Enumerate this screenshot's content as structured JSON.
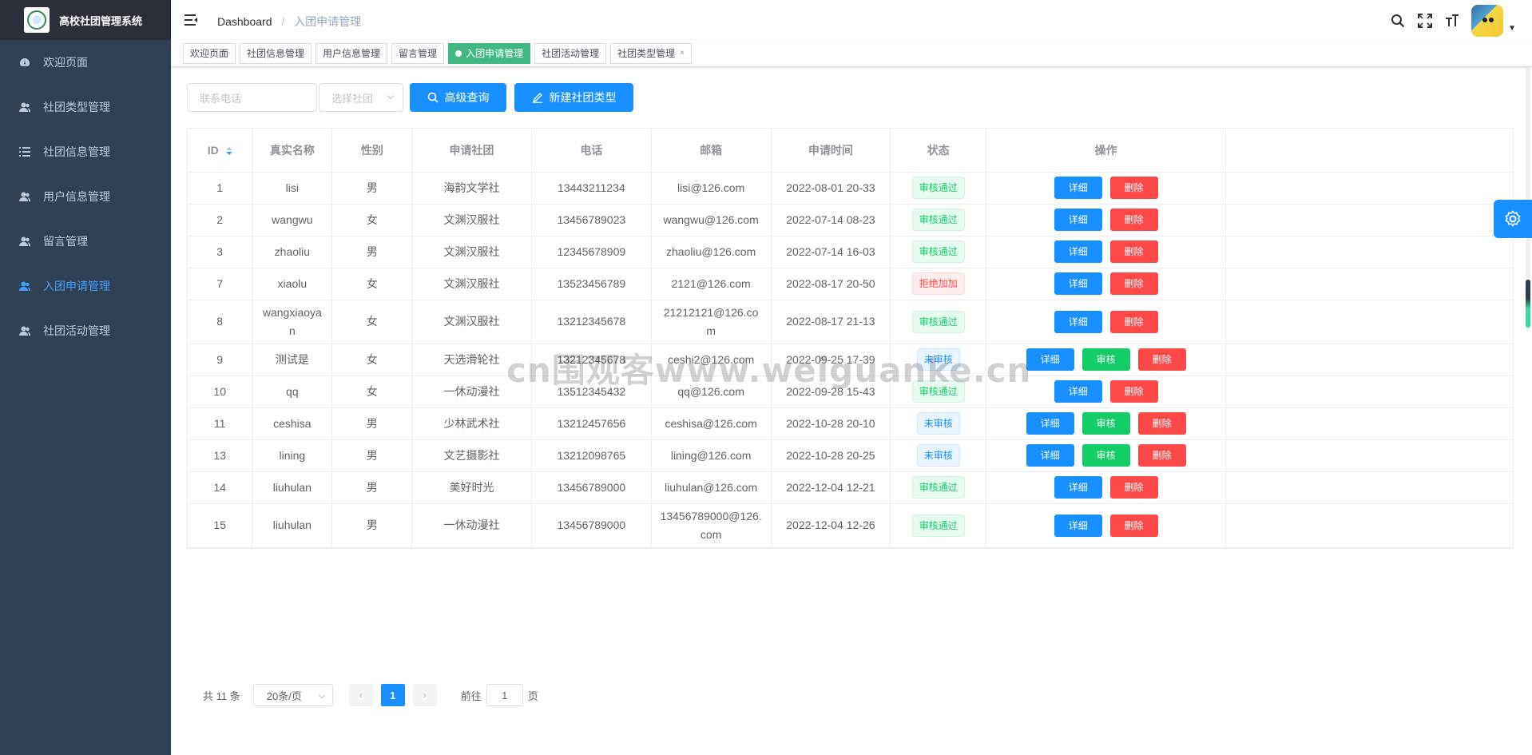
{
  "app": {
    "title": "高校社团管理系统"
  },
  "sidebar": {
    "items": [
      {
        "label": "欢迎页面",
        "icon": "dashboard-icon",
        "active": false
      },
      {
        "label": "社团类型管理",
        "icon": "user-icon",
        "active": false
      },
      {
        "label": "社团信息管理",
        "icon": "list-icon",
        "active": false
      },
      {
        "label": "用户信息管理",
        "icon": "user-icon",
        "active": false
      },
      {
        "label": "留言管理",
        "icon": "user-icon",
        "active": false
      },
      {
        "label": "入团申请管理",
        "icon": "user-icon",
        "active": true
      },
      {
        "label": "社团活动管理",
        "icon": "user-icon",
        "active": false
      }
    ]
  },
  "navbar": {
    "breadcrumb": {
      "home": "Dashboard",
      "separator": "/",
      "current": "入团申请管理"
    }
  },
  "tags": [
    {
      "label": "欢迎页面",
      "active": false,
      "closable": false
    },
    {
      "label": "社团信息管理",
      "active": false,
      "closable": false
    },
    {
      "label": "用户信息管理",
      "active": false,
      "closable": false
    },
    {
      "label": "留言管理",
      "active": false,
      "closable": false
    },
    {
      "label": "入团申请管理",
      "active": true,
      "closable": false
    },
    {
      "label": "社团活动管理",
      "active": false,
      "closable": false
    },
    {
      "label": "社团类型管理",
      "active": false,
      "closable": true,
      "close_symbol": "×"
    }
  ],
  "filters": {
    "phone_placeholder": "联系电话",
    "club_placeholder": "选择社团",
    "search_label": "高级查询",
    "create_label": "新建社团类型"
  },
  "table": {
    "headers": [
      "ID",
      "真实名称",
      "性别",
      "申请社团",
      "电话",
      "邮箱",
      "申请时间",
      "状态",
      "操作"
    ],
    "actions": {
      "detail": "详细",
      "audit": "审核",
      "delete": "删除"
    },
    "rows": [
      {
        "id": "1",
        "name": "lisi",
        "gender": "男",
        "club": "海韵文学社",
        "phone": "13443211234",
        "email": "lisi@126.com",
        "time": "2022-08-01 20-33",
        "status": "审核通过",
        "status_type": "pass"
      },
      {
        "id": "2",
        "name": "wangwu",
        "gender": "女",
        "club": "文渊汉服社",
        "phone": "13456789023",
        "email": "wangwu@126.com",
        "time": "2022-07-14 08-23",
        "status": "审核通过",
        "status_type": "pass"
      },
      {
        "id": "3",
        "name": "zhaoliu",
        "gender": "男",
        "club": "文渊汉服社",
        "phone": "12345678909",
        "email": "zhaoliu@126.com",
        "time": "2022-07-14 16-03",
        "status": "审核通过",
        "status_type": "pass"
      },
      {
        "id": "7",
        "name": "xiaolu",
        "gender": "女",
        "club": "文渊汉服社",
        "phone": "13523456789",
        "email": "2121@126.com",
        "time": "2022-08-17 20-50",
        "status": "拒绝加加",
        "status_type": "reject"
      },
      {
        "id": "8",
        "name": "wangxiaoyan",
        "gender": "女",
        "club": "文渊汉服社",
        "phone": "13212345678",
        "email": "21212121@126.com",
        "time": "2022-08-17 21-13",
        "status": "审核通过",
        "status_type": "pass"
      },
      {
        "id": "9",
        "name": "测试是",
        "gender": "女",
        "club": "天选滑轮社",
        "phone": "13212345678",
        "email": "ceshi2@126.com",
        "time": "2022-09-25 17-39",
        "status": "未审核",
        "status_type": "pending"
      },
      {
        "id": "10",
        "name": "qq",
        "gender": "女",
        "club": "一休动漫社",
        "phone": "13512345432",
        "email": "qq@126.com",
        "time": "2022-09-28 15-43",
        "status": "审核通过",
        "status_type": "pass"
      },
      {
        "id": "11",
        "name": "ceshisa",
        "gender": "男",
        "club": "少林武术社",
        "phone": "13212457656",
        "email": "ceshisa@126.com",
        "time": "2022-10-28 20-10",
        "status": "未审核",
        "status_type": "pending"
      },
      {
        "id": "13",
        "name": "lining",
        "gender": "男",
        "club": "文艺摄影社",
        "phone": "13212098765",
        "email": "lining@126.com",
        "time": "2022-10-28 20-25",
        "status": "未审核",
        "status_type": "pending"
      },
      {
        "id": "14",
        "name": "liuhulan",
        "gender": "男",
        "club": "美好时光",
        "phone": "13456789000",
        "email": "liuhulan@126.com",
        "time": "2022-12-04 12-21",
        "status": "审核通过",
        "status_type": "pass"
      },
      {
        "id": "15",
        "name": "liuhulan",
        "gender": "男",
        "club": "一休动漫社",
        "phone": "13456789000",
        "email": "13456789000@126.com",
        "time": "2022-12-04 12-26",
        "status": "审核通过",
        "status_type": "pass"
      }
    ]
  },
  "pagination": {
    "total_text": "共 11 条",
    "page_size": "20条/页",
    "prev": "‹",
    "current_page": "1",
    "next": "›",
    "goto_label": "前往",
    "goto_value": "1",
    "page_suffix": "页"
  },
  "watermark": "cn围观客www.weiguanke.cn",
  "colors": {
    "sidebar_bg": "#304156",
    "primary": "#1890ff",
    "active_tag": "#42b983",
    "success": "#13ce66",
    "danger": "#ff4949"
  }
}
